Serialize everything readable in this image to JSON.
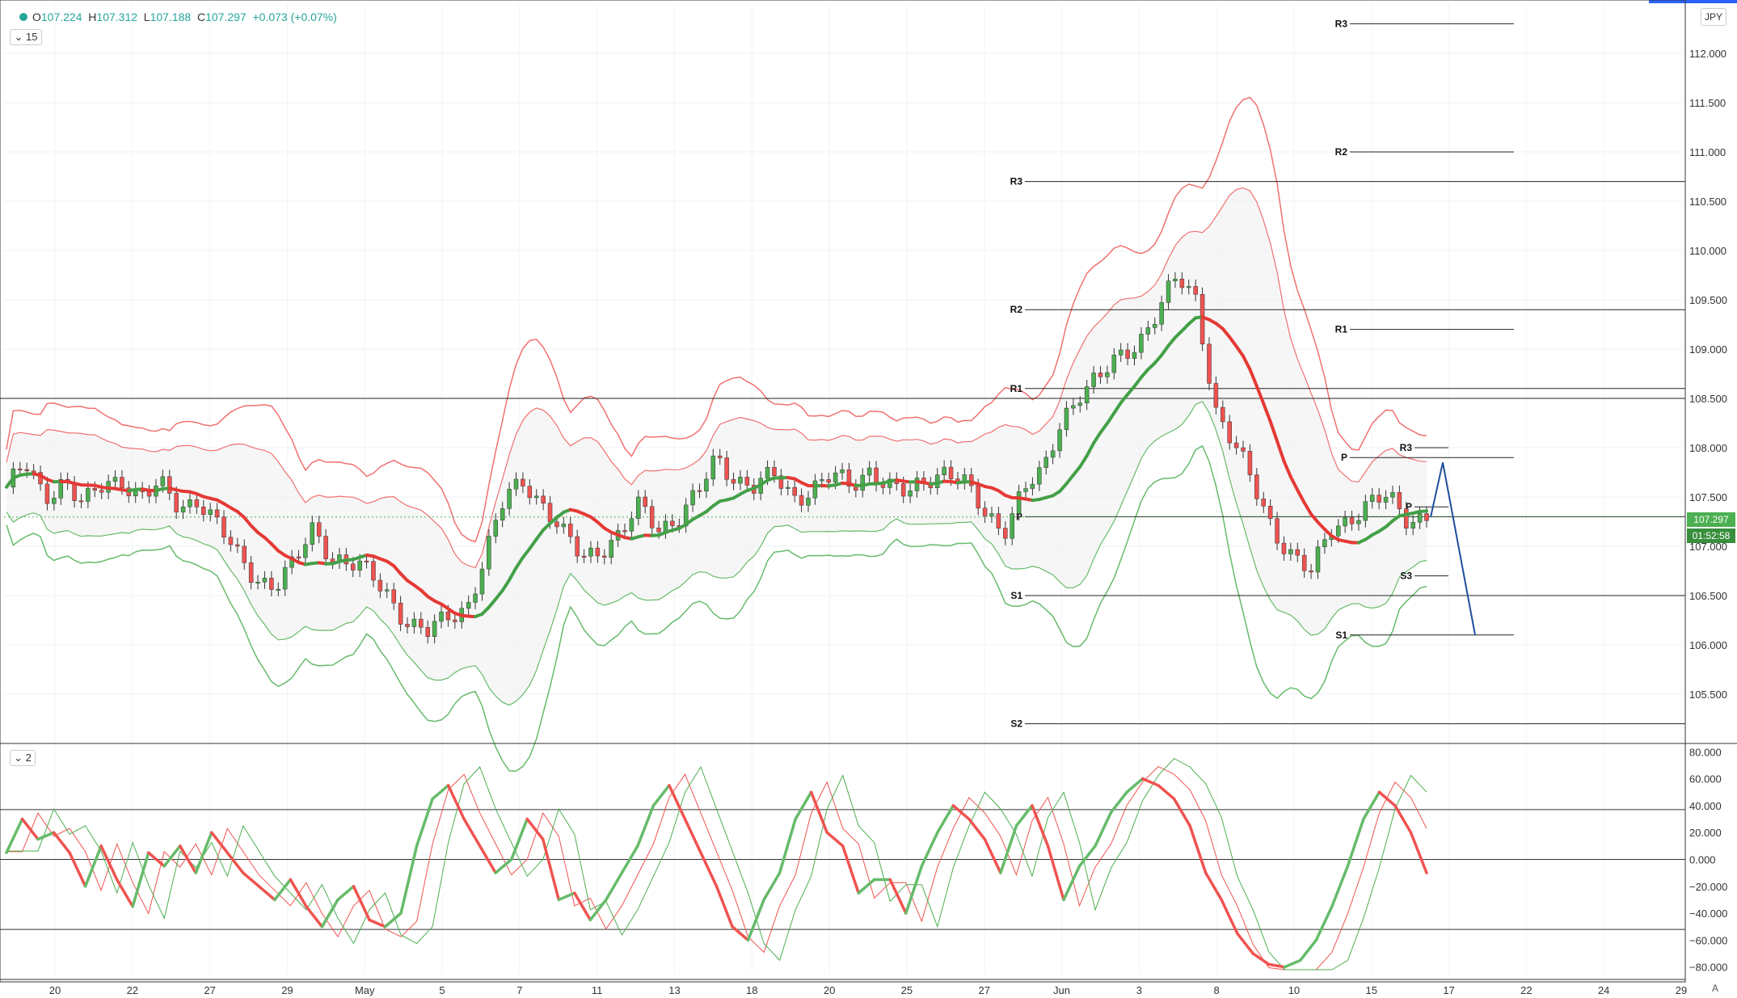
{
  "symbol_header": {
    "open_label": "O",
    "open": "107.224",
    "high_label": "H",
    "high": "107.312",
    "low_label": "L",
    "low": "107.188",
    "close_label": "C",
    "close": "107.297",
    "change": "+0.073 (+0.07%)"
  },
  "interval_main": "15",
  "interval_osc": "2",
  "currency_button": "JPY",
  "current_price_tag": "107.297",
  "countdown_tag": "01:52:58",
  "auto_label": "A",
  "colors": {
    "bull": "#4caf50",
    "bear": "#ef5350",
    "band_red": "#f07070",
    "band_green": "#66bb6a",
    "projection": "#1f4e9c",
    "price_tag": "#4caf50"
  },
  "chart_data": [
    {
      "type": "candlestick",
      "name": "price",
      "ylim": [
        105.0,
        112.5
      ],
      "y_ticks": [
        "112.000",
        "111.500",
        "111.000",
        "110.500",
        "110.000",
        "109.500",
        "109.000",
        "108.500",
        "108.000",
        "107.500",
        "107.000",
        "106.500",
        "106.000",
        "105.500"
      ],
      "x_tick_labels": [
        "20",
        "22",
        "27",
        "29",
        "May",
        "5",
        "7",
        "11",
        "13",
        "18",
        "20",
        "25",
        "27",
        "Jun",
        "3",
        "8",
        "10",
        "15",
        "17",
        "22",
        "24",
        "29"
      ],
      "horizontal_levels": [
        {
          "label": "R3",
          "value": 110.7
        },
        {
          "label": "R2",
          "value": 109.4
        },
        {
          "label": "R1",
          "value": 108.6
        },
        {
          "label": "",
          "value": 108.5
        },
        {
          "label": "P",
          "value": 107.3
        },
        {
          "label": "S1",
          "value": 106.5
        },
        {
          "label": "S2",
          "value": 105.2
        }
      ],
      "weekly_pivots": [
        {
          "label": "R3",
          "value": 112.3
        },
        {
          "label": "R2",
          "value": 111.0
        },
        {
          "label": "R1",
          "value": 109.2
        },
        {
          "label": "P",
          "value": 107.9
        },
        {
          "label": "S1",
          "value": 106.1
        }
      ],
      "intraday_pivots": [
        {
          "label": "R3",
          "value": 108.0
        },
        {
          "label": "P",
          "value": 107.4
        },
        {
          "label": "S3",
          "value": 106.7
        }
      ],
      "close_path": [
        107.6,
        107.8,
        107.5,
        107.7,
        107.4,
        107.6,
        107.7,
        107.5,
        107.6,
        107.4,
        107.5,
        107.2,
        106.9,
        106.7,
        106.6,
        106.8,
        107.2,
        106.9,
        106.8,
        106.7,
        106.5,
        106.2,
        106.1,
        106.3,
        106.4,
        106.9,
        107.5,
        107.7,
        107.4,
        107.1,
        106.9,
        107.0,
        107.1,
        107.4,
        107.2,
        107.3,
        107.5,
        107.9,
        107.7,
        107.6,
        107.7,
        107.5,
        107.6,
        107.7,
        107.6,
        107.8,
        107.6,
        107.5,
        107.7,
        107.8,
        107.6,
        107.3,
        107.2,
        107.6,
        107.7,
        108.3,
        108.6,
        108.7,
        108.9,
        109.1,
        109.4,
        109.7,
        109.5,
        108.4,
        108.0,
        107.6,
        107.2,
        106.9,
        106.7,
        107.2,
        107.3,
        107.4,
        107.5,
        107.3,
        107.3
      ],
      "current_price": 107.297,
      "projection": [
        {
          "price": 107.297
        },
        {
          "price": 107.85
        },
        {
          "price": 106.1
        }
      ]
    },
    {
      "type": "line",
      "name": "oscillator",
      "ylim": [
        -85,
        85
      ],
      "y_ticks": [
        "80.000",
        "60.000",
        "40.000",
        "20.000",
        "0.000",
        "−20.000",
        "−40.000",
        "−60.000",
        "−80.000"
      ],
      "levels": [
        37,
        0,
        -52
      ],
      "values": [
        5,
        30,
        15,
        20,
        5,
        -20,
        10,
        -15,
        -35,
        5,
        -5,
        10,
        -10,
        20,
        5,
        -10,
        -20,
        -30,
        -15,
        -35,
        -50,
        -30,
        -20,
        -45,
        -50,
        -40,
        10,
        45,
        55,
        30,
        10,
        -10,
        0,
        30,
        15,
        -30,
        -25,
        -45,
        -30,
        -10,
        10,
        40,
        55,
        30,
        5,
        -20,
        -50,
        -60,
        -30,
        -10,
        30,
        50,
        20,
        10,
        -25,
        -15,
        -15,
        -40,
        -5,
        20,
        40,
        30,
        15,
        -10,
        25,
        40,
        10,
        -30,
        -5,
        10,
        35,
        50,
        60,
        55,
        45,
        25,
        -10,
        -30,
        -55,
        -70,
        -78,
        -80,
        -75,
        -60,
        -35,
        -5,
        30,
        50,
        40,
        20,
        -10
      ]
    }
  ]
}
